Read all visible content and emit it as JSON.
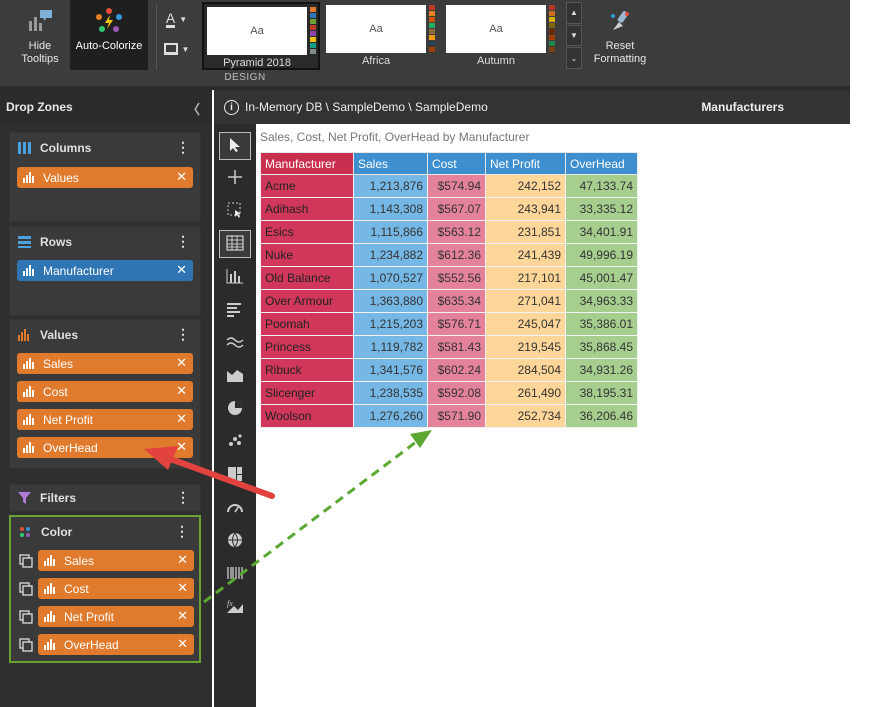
{
  "ribbon": {
    "hide_tooltips": "Hide\nTooltips",
    "auto_colorize": "Auto-Colorize",
    "reset_formatting": "Reset\nFormatting",
    "group_label": "DESIGN",
    "themes": [
      {
        "name": "Pyramid 2018",
        "preview": "Aa",
        "selected": true,
        "swatches": [
          "#e07a2c",
          "#2f74b3",
          "#6aa132",
          "#c0392b",
          "#8e44ad",
          "#f1c40f",
          "#16a085",
          "#7f8c8d"
        ]
      },
      {
        "name": "Africa",
        "preview": "Aa",
        "selected": false,
        "swatches": [
          "#c0392b",
          "#e67e22",
          "#d35400",
          "#27ae60",
          "#8e6a3a",
          "#f39c12",
          "#2c3e50",
          "#a04000"
        ]
      },
      {
        "name": "Autumn",
        "preview": "Aa",
        "selected": false,
        "swatches": [
          "#b03a2e",
          "#ca6f1e",
          "#d4ac0d",
          "#7d6608",
          "#6e2c00",
          "#a04000",
          "#1e8449",
          "#784212"
        ]
      }
    ]
  },
  "panel": {
    "title": "Drop Zones",
    "zones": {
      "columns": {
        "title": "Columns",
        "items": [
          "Values"
        ]
      },
      "rows": {
        "title": "Rows",
        "items": [
          "Manufacturer"
        ]
      },
      "values": {
        "title": "Values",
        "items": [
          "Sales",
          "Cost",
          "Net Profit",
          "OverHead"
        ]
      },
      "filters": {
        "title": "Filters"
      },
      "color": {
        "title": "Color",
        "items": [
          "Sales",
          "Cost",
          "Net Profit",
          "OverHead"
        ]
      }
    }
  },
  "breadcrumb": {
    "path": "In-Memory DB \\ SampleDemo \\ SampleDemo",
    "right": "Manufacturers"
  },
  "grid": {
    "title": "Sales, Cost, Net Profit, OverHead by Manufacturer",
    "headers": [
      "Manufacturer",
      "Sales",
      "Cost",
      "Net Profit",
      "OverHead"
    ],
    "rows": [
      [
        "Acme",
        "1,213,876",
        "$574.94",
        "242,152",
        "47,133.74"
      ],
      [
        "Adihash",
        "1,143,308",
        "$567.07",
        "243,941",
        "33,335.12"
      ],
      [
        "Esics",
        "1,115,866",
        "$563.12",
        "231,851",
        "34,401.91"
      ],
      [
        "Nuke",
        "1,234,882",
        "$612.36",
        "241,439",
        "49,996.19"
      ],
      [
        "Old Balance",
        "1,070,527",
        "$552.56",
        "217,101",
        "45,001.47"
      ],
      [
        "Over Armour",
        "1,363,880",
        "$635.34",
        "271,041",
        "34,963.33"
      ],
      [
        "Poomah",
        "1,215,203",
        "$576.71",
        "245,047",
        "35,386.01"
      ],
      [
        "Princess",
        "1,119,782",
        "$581.43",
        "219,545",
        "35,868.45"
      ],
      [
        "Ribuck",
        "1,341,576",
        "$602.24",
        "284,504",
        "34,931.26"
      ],
      [
        "Slicenger",
        "1,238,535",
        "$592.08",
        "261,490",
        "38,195.31"
      ],
      [
        "Woolson",
        "1,276,260",
        "$571.90",
        "252,734",
        "36,206.46"
      ]
    ],
    "colors": {
      "header": [
        "#c9304f",
        "#3d8fd0",
        "#3d8fd0",
        "#3d8fd0",
        "#3d8fd0"
      ],
      "body": [
        "#d0375a",
        "#75b8e6",
        "#e5829b",
        "#ffd699",
        "#a6cf8f"
      ]
    }
  },
  "colors": {
    "accent_orange": "#e07a2c",
    "accent_blue": "#2f74b3",
    "color_zone_border": "#6aa132",
    "red_arrow": "#e2433f",
    "green_arrow": "#5aa832"
  }
}
